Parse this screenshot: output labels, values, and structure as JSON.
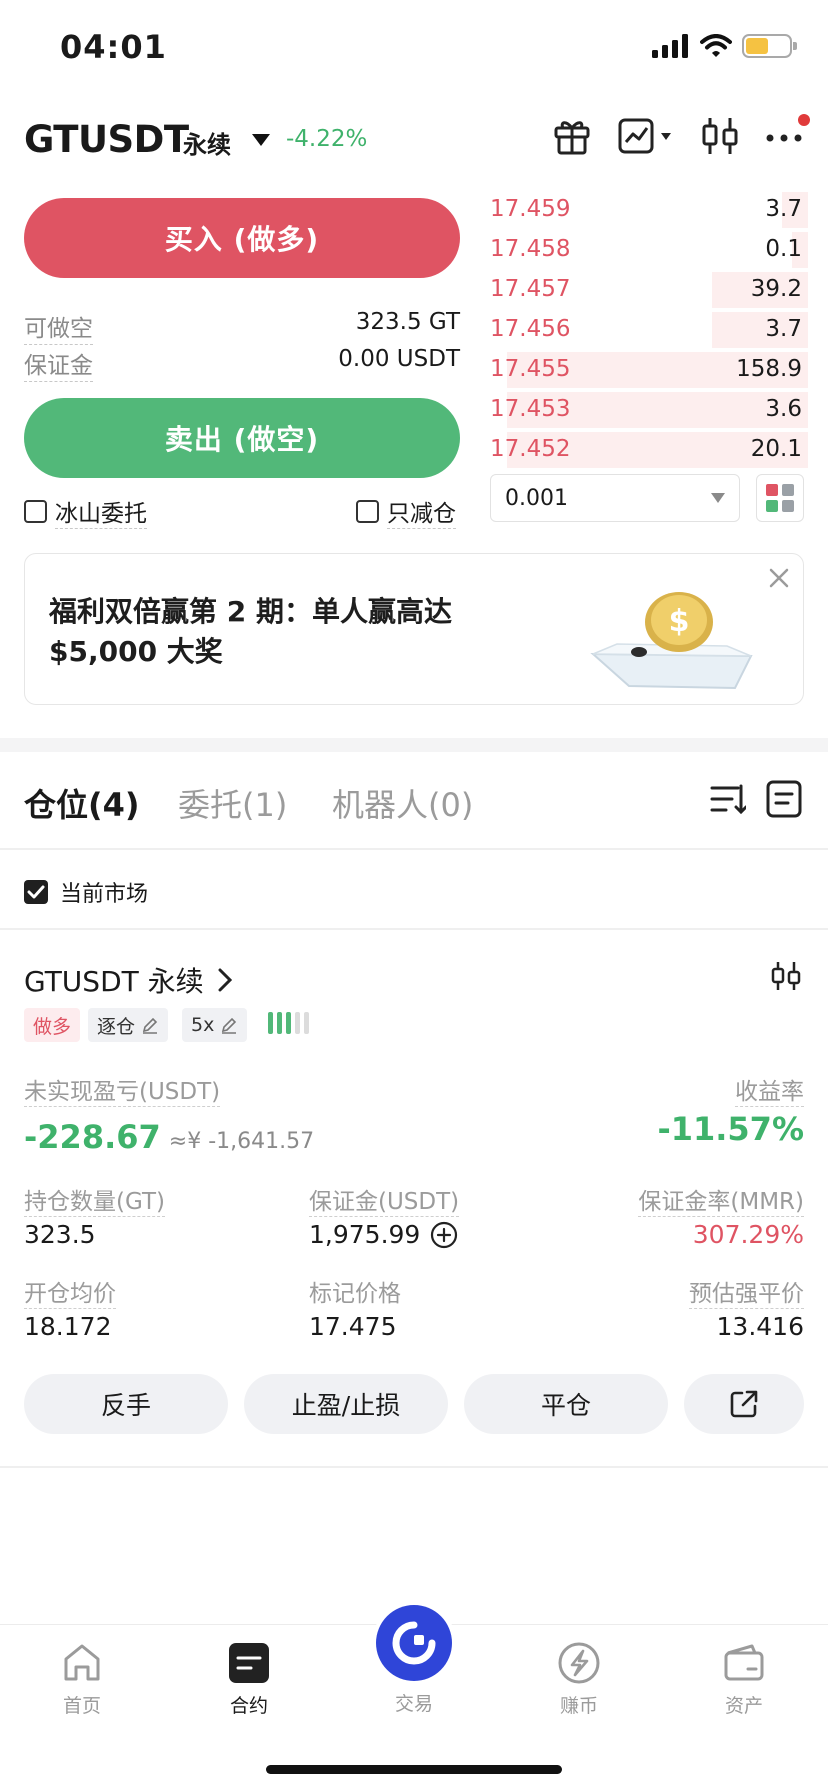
{
  "status_bar": {
    "time": "04:01"
  },
  "header": {
    "pair": "GTUSDT",
    "contract_type": "永续",
    "change": "-4.22%"
  },
  "trade": {
    "buy_label": "买入 (做多)",
    "sell_label": "卖出 (做空)",
    "short_available_label": "可做空",
    "short_available_value": "323.5 GT",
    "margin_label": "保证金",
    "margin_value": "0.00 USDT",
    "iceberg_label": "冰山委托",
    "reduce_only_label": "只减仓"
  },
  "order_book": {
    "asks": [
      {
        "price": "17.459",
        "qty": "3.7",
        "depth": 0.08
      },
      {
        "price": "17.458",
        "qty": "0.1",
        "depth": 0.05
      },
      {
        "price": "17.457",
        "qty": "39.2",
        "depth": 0.3
      },
      {
        "price": "17.456",
        "qty": "3.7",
        "depth": 0.3
      },
      {
        "price": "17.455",
        "qty": "158.9",
        "depth": 0.94
      },
      {
        "price": "17.453",
        "qty": "3.6",
        "depth": 0.94
      },
      {
        "price": "17.452",
        "qty": "20.1",
        "depth": 0.94
      }
    ],
    "step": "0.001"
  },
  "banner": {
    "text": "福利双倍赢第 2 期：单人赢高达 $5,000 大奖"
  },
  "tabs": {
    "positions": "仓位(4)",
    "orders": "委托(1)",
    "bots": "机器人(0)"
  },
  "filter": {
    "current_market_label": "当前市场"
  },
  "position": {
    "title": "GTUSDT 永续",
    "tag_side": "做多",
    "tag_margin_mode": "逐仓",
    "tag_leverage": "5x",
    "adl_level": 3,
    "unrealized_pnl_label": "未实现盈亏(USDT)",
    "unrealized_pnl_value": "-228.67",
    "unrealized_pnl_cny": "≈¥ -1,641.57",
    "roe_label": "收益率",
    "roe_value": "-11.57%",
    "size_label": "持仓数量(GT)",
    "size_value": "323.5",
    "margin_label": "保证金(USDT)",
    "margin_value": "1,975.99",
    "mmr_label": "保证金率(MMR)",
    "mmr_value": "307.29%",
    "entry_label": "开仓均价",
    "entry_value": "18.172",
    "mark_label": "标记价格",
    "mark_value": "17.475",
    "liq_label": "预估强平价",
    "liq_value": "13.416",
    "btn_reverse": "反手",
    "btn_tpsl": "止盈/止损",
    "btn_close": "平仓"
  },
  "bottom_nav": {
    "home": "首页",
    "futures": "合约",
    "trade": "交易",
    "earn": "赚币",
    "assets": "资产"
  },
  "colors": {
    "buy": "#df5463",
    "sell": "#52b879",
    "positive_text": "#3fb26b",
    "negative_text": "#df5463",
    "trade_button": "#2f45d8"
  }
}
